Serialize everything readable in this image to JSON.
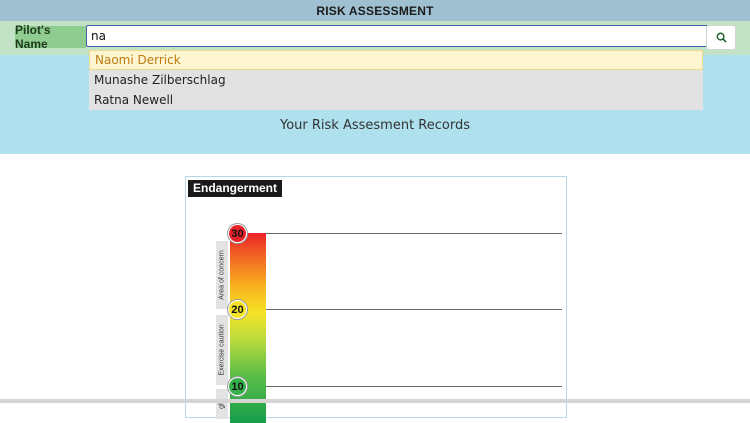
{
  "header": {
    "title": "RISK ASSESSMENT"
  },
  "search": {
    "label": "Pilot's Name",
    "value": "na",
    "button_icon": "search-icon",
    "suggestions": [
      {
        "label": "Naomi Derrick",
        "active": true
      },
      {
        "label": "Munashe Zilberschlag",
        "active": false
      },
      {
        "label": "Ratna Newell",
        "active": false
      }
    ]
  },
  "main": {
    "heading": "Your Risk Assesment Records"
  },
  "endangerment": {
    "title": "Endangerment",
    "levels": [
      "30",
      "20",
      "10"
    ],
    "zones": [
      "Area of concern",
      "Exercise caution",
      "ght"
    ]
  }
}
